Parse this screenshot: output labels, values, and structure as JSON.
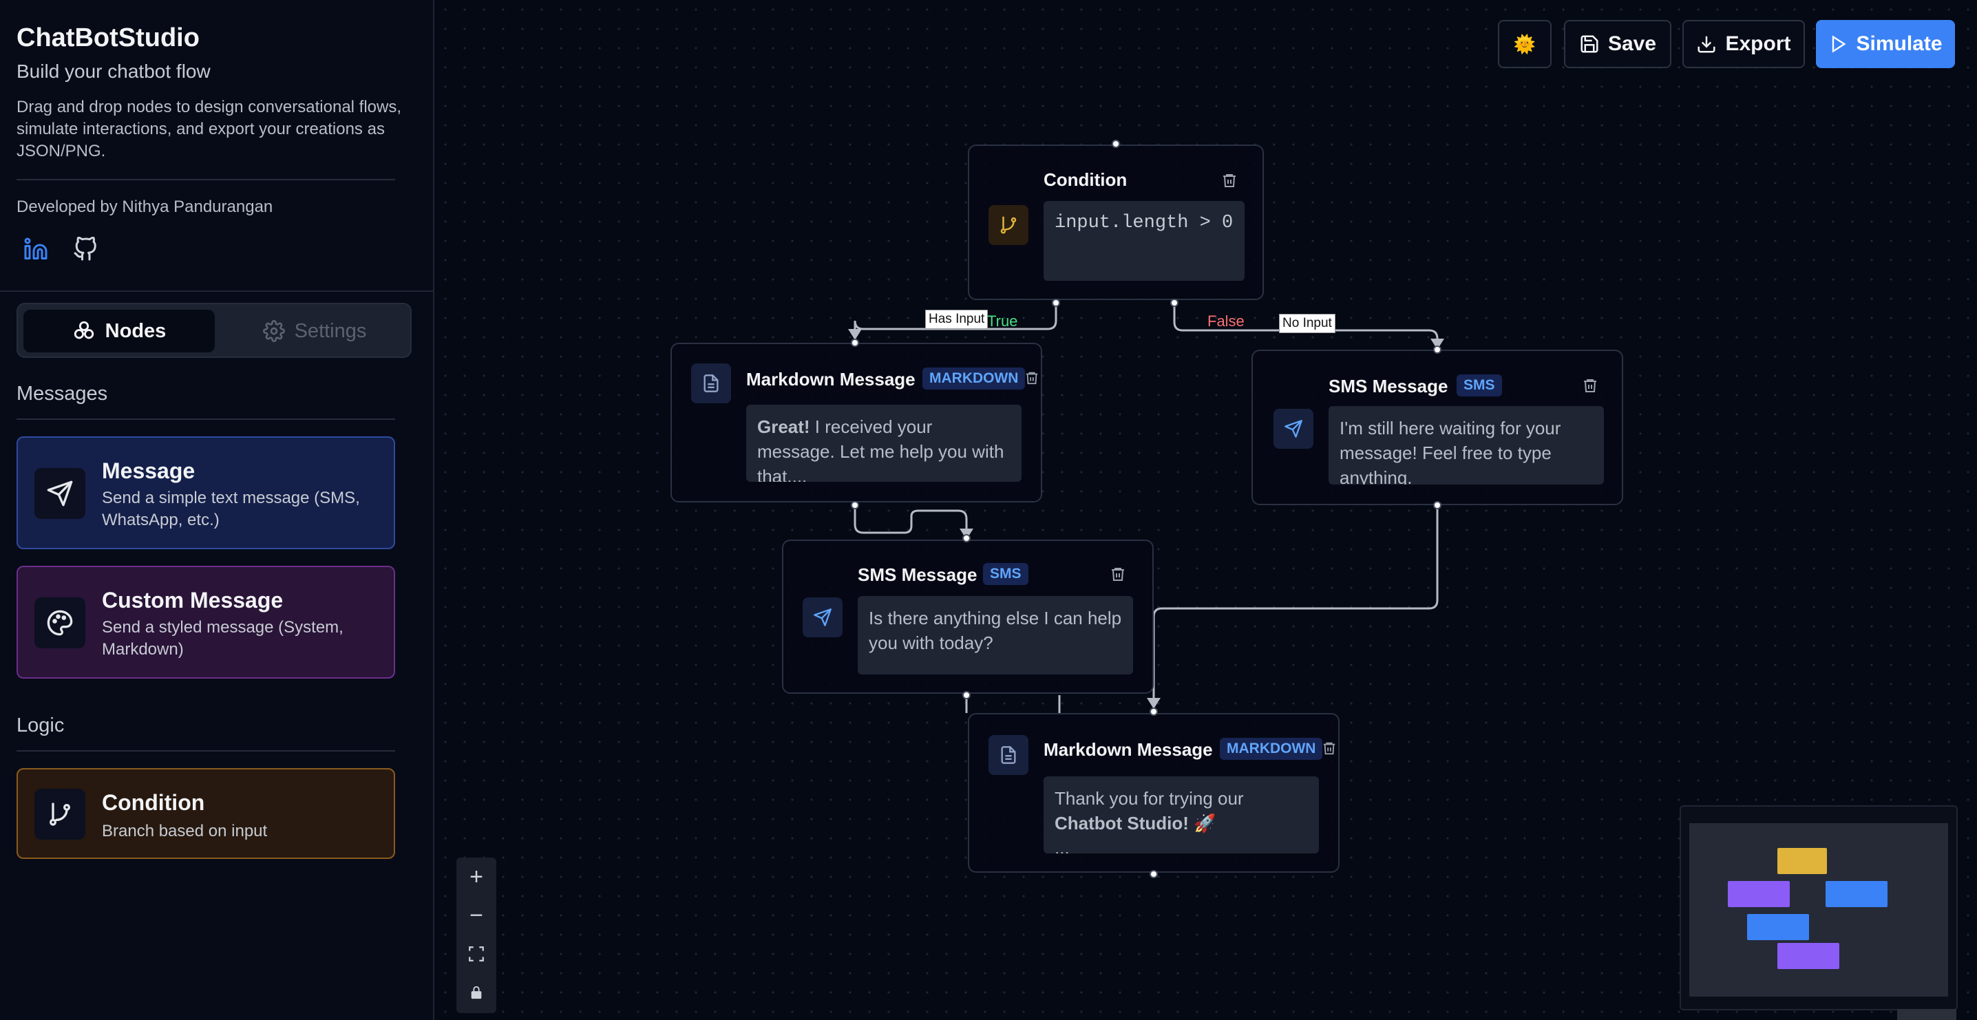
{
  "sidebar": {
    "app_title": "ChatBotStudio",
    "subtitle": "Build your chatbot flow",
    "description": "Drag and drop nodes to design conversational flows, simulate interactions, and export your creations as JSON/PNG.",
    "developer": "Developed by Nithya Pandurangan",
    "tabs": {
      "nodes": "Nodes",
      "settings": "Settings"
    },
    "sections": {
      "messages": "Messages",
      "logic": "Logic"
    },
    "node_types": {
      "message": {
        "title": "Message",
        "desc": "Send a simple text message (SMS, WhatsApp, etc.)"
      },
      "custom": {
        "title": "Custom Message",
        "desc": "Send a styled message (System, Markdown)"
      },
      "condition": {
        "title": "Condition",
        "desc": "Branch based on input"
      }
    }
  },
  "toolbar": {
    "theme_icon": "🌞",
    "save": "Save",
    "export": "Export",
    "simulate": "Simulate"
  },
  "flow": {
    "condition": {
      "title": "Condition",
      "expr": "input.length > 0"
    },
    "md1": {
      "title": "Markdown Message",
      "badge": "MARKDOWN",
      "bold": "Great!",
      "text": " I received your message. Let me help you with that...."
    },
    "sms_right": {
      "title": "SMS Message",
      "badge": "SMS",
      "text": "I'm still here waiting for your message! Feel free to type anything."
    },
    "sms_mid": {
      "title": "SMS Message",
      "badge": "SMS",
      "text": "Is there anything else I can help you with today?"
    },
    "md2": {
      "title": "Markdown Message",
      "badge": "MARKDOWN",
      "text": "Thank you for trying our ",
      "bold": "Chatbot Studio! 🚀",
      "more": "..."
    },
    "edges": {
      "has_input": "Has Input",
      "true_label": "True",
      "false_label": "False",
      "no_input": "No Input"
    }
  },
  "colors": {
    "accent": "#3b82f6",
    "true": "#4ade80",
    "false": "#f87171",
    "condition_yellow": "#e0b43a",
    "minimap_purple": "#8b5cf6",
    "minimap_blue": "#3b82f6"
  }
}
